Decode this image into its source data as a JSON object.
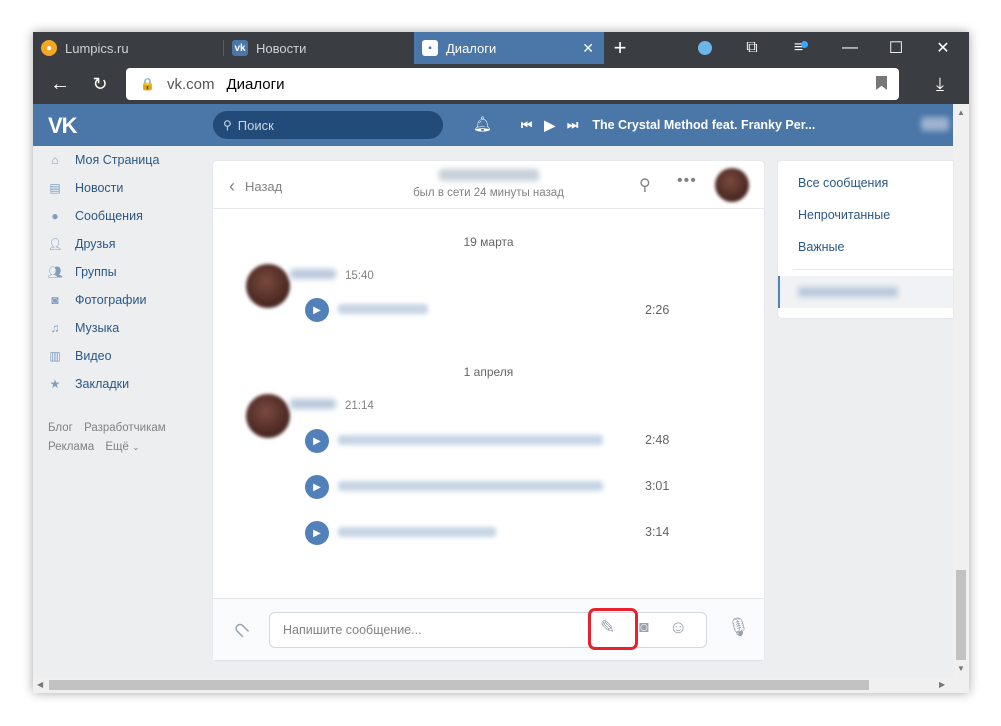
{
  "browser": {
    "tabs": [
      {
        "title": "Lumpics.ru"
      },
      {
        "title": "Новости"
      },
      {
        "title": "Диалоги"
      }
    ],
    "url_domain": "vk.com",
    "url_title": "Диалоги"
  },
  "vk": {
    "search_placeholder": "Поиск",
    "now_playing": "The Crystal Method feat. Franky Per...",
    "menu": [
      {
        "label": "Моя Страница",
        "icon": "home-icon"
      },
      {
        "label": "Новости",
        "icon": "news-icon"
      },
      {
        "label": "Сообщения",
        "icon": "messages-icon"
      },
      {
        "label": "Друзья",
        "icon": "friends-icon"
      },
      {
        "label": "Группы",
        "icon": "groups-icon"
      },
      {
        "label": "Фотографии",
        "icon": "camera-icon"
      },
      {
        "label": "Музыка",
        "icon": "music-icon"
      },
      {
        "label": "Видео",
        "icon": "video-icon"
      },
      {
        "label": "Закладки",
        "icon": "star-icon"
      }
    ],
    "footer_links": [
      "Блог",
      "Разработчикам",
      "Реклама",
      "Ещё"
    ]
  },
  "dialog": {
    "back_label": "Назад",
    "status": "был в сети 24 минуты назад",
    "groups": [
      {
        "date": "19 марта",
        "time": "15:40",
        "tracks": [
          {
            "duration": "2:26"
          }
        ]
      },
      {
        "date": "1 апреля",
        "time": "21:14",
        "tracks": [
          {
            "duration": "2:48"
          },
          {
            "duration": "3:01"
          },
          {
            "duration": "3:14"
          }
        ]
      }
    ],
    "composer_placeholder": "Напишите сообщение..."
  },
  "right": {
    "items": [
      "Все сообщения",
      "Непрочитанные",
      "Важные"
    ]
  },
  "colors": {
    "vk_blue": "#4a76a8",
    "link": "#2a5885",
    "highlight": "#e8212d"
  }
}
